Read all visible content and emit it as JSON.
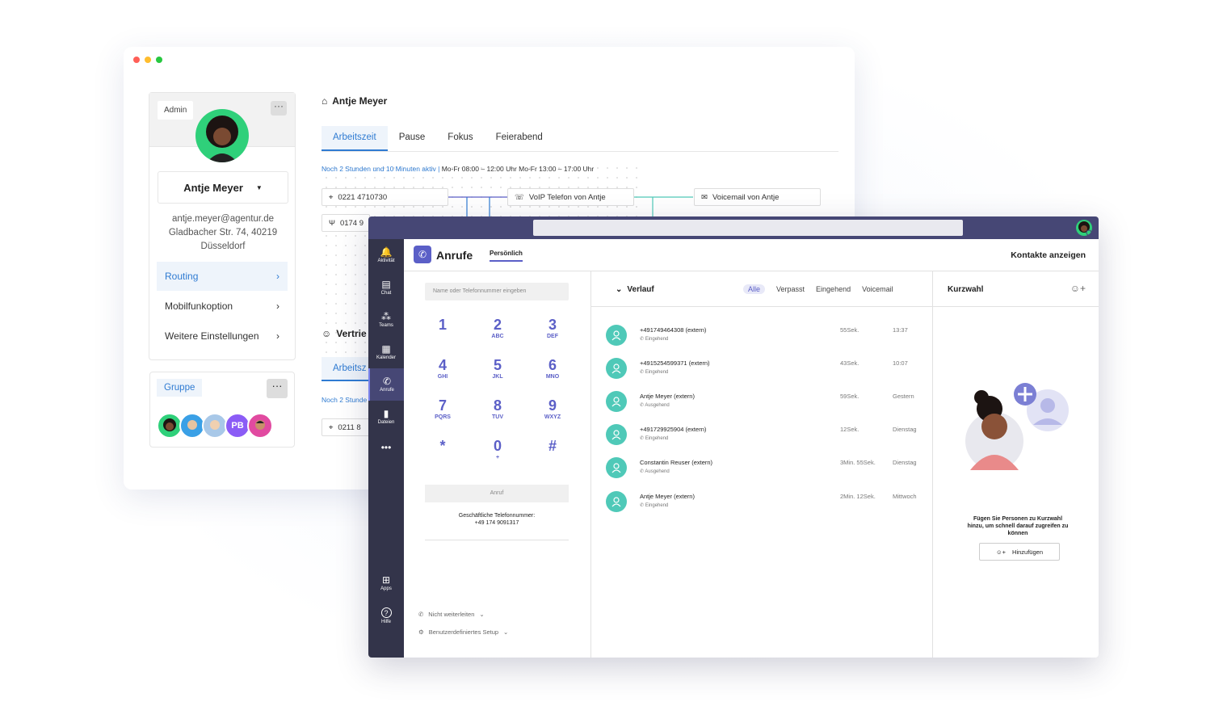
{
  "colors": {
    "teams_purple": "#5b5fc7",
    "teams_topbar": "#464775",
    "teams_rail": "#33344a",
    "accent_blue": "#2f7bd2",
    "avatar_teal": "#4fc9b8",
    "status_green": "#2fd07a"
  },
  "back_window": {
    "profile": {
      "role_tag": "Admin",
      "name": "Antje Meyer",
      "email": "antje.meyer@agentur.de",
      "address_line1": "Gladbacher Str. 74, 40219",
      "address_line2": "Düsseldorf",
      "menu": [
        "Routing",
        "Mobilfunkoption",
        "Weitere Einstellungen"
      ]
    },
    "group": {
      "label": "Gruppe",
      "initials": "PB"
    },
    "routing": {
      "title": "Antje Meyer",
      "tabs": [
        "Arbeitszeit",
        "Pause",
        "Fokus",
        "Feierabend"
      ],
      "status_active": "Noch 2 Stunden und 10 Minuten aktiv",
      "schedule": "Mo-Fr   08:00 – 12:00 Uhr   Mo-Fr   13:00 – 17:00 Uhr",
      "node_phone": "0221 4710730",
      "node_mobile": "0174 9",
      "node_voip": "VoIP Telefon von Antje",
      "node_voicemail": "Voicemail von Antje",
      "section2_title": "Vertrie",
      "section2_tab": "Arbeitsz",
      "section2_status": "Noch 2 Stunde",
      "section2_node": "0211 8"
    }
  },
  "teams": {
    "rail": [
      {
        "label": "Aktivität",
        "icon": "bell-icon",
        "glyph": "🔔"
      },
      {
        "label": "Chat",
        "icon": "chat-icon",
        "glyph": "▤"
      },
      {
        "label": "Teams",
        "icon": "teams-icon",
        "glyph": "⁂"
      },
      {
        "label": "Kalender",
        "icon": "calendar-icon",
        "glyph": "▦"
      },
      {
        "label": "Anrufe",
        "icon": "phone-icon",
        "glyph": "✆"
      },
      {
        "label": "Dateien",
        "icon": "file-icon",
        "glyph": "▮"
      }
    ],
    "rail_more": "•••",
    "rail_bottom": [
      {
        "label": "Apps",
        "icon": "apps-icon",
        "glyph": "⊞"
      },
      {
        "label": "Hilfe",
        "icon": "help-icon",
        "glyph": "?"
      }
    ],
    "app_title": "Anrufe",
    "sub_tab": "Persönlich",
    "contacts_link": "Kontakte anzeigen",
    "dialpad": {
      "placeholder": "Name oder Telefonnummer eingeben",
      "keys": [
        {
          "num": "1",
          "let": ""
        },
        {
          "num": "2",
          "let": "ABC"
        },
        {
          "num": "3",
          "let": "DEF"
        },
        {
          "num": "4",
          "let": "GHI"
        },
        {
          "num": "5",
          "let": "JKL"
        },
        {
          "num": "6",
          "let": "MNO"
        },
        {
          "num": "7",
          "let": "PQRS"
        },
        {
          "num": "8",
          "let": "TUV"
        },
        {
          "num": "9",
          "let": "WXYZ"
        },
        {
          "num": "*",
          "let": ""
        },
        {
          "num": "0",
          "let": "+"
        },
        {
          "num": "#",
          "let": ""
        }
      ],
      "call_button": "Anruf",
      "business_label": "Geschäftliche Telefonnummer:",
      "business_number": "+49 174 9091317",
      "forward_option": "Nicht weiterleiten",
      "setup_option": "Benutzerdefiniertes Setup"
    },
    "history": {
      "title": "Verlauf",
      "filters": [
        "Alle",
        "Verpasst",
        "Eingehend",
        "Voicemail"
      ],
      "calls": [
        {
          "name": "+491749464308 (extern)",
          "type": "Eingehend",
          "duration": "55Sek.",
          "when": "13:37"
        },
        {
          "name": "+4915254599371 (extern)",
          "type": "Eingehend",
          "duration": "43Sek.",
          "when": "10:07"
        },
        {
          "name": "Antje Meyer (extern)",
          "type": "Ausgehend",
          "duration": "59Sek.",
          "when": "Gestern"
        },
        {
          "name": "+491729925904 (extern)",
          "type": "Eingehend",
          "duration": "12Sek.",
          "when": "Dienstag"
        },
        {
          "name": "Constantin Reuser (extern)",
          "type": "Ausgehend",
          "duration": "3Min. 55Sek.",
          "when": "Dienstag"
        },
        {
          "name": "Antje Meyer (extern)",
          "type": "Eingehend",
          "duration": "2Min. 12Sek.",
          "when": "Mittwoch"
        }
      ]
    },
    "speed_dial": {
      "title": "Kurzwahl",
      "text": "Fügen Sie Personen zu Kurzwahl hinzu, um schnell darauf zugreifen zu können",
      "add_button": "Hinzufügen"
    }
  }
}
